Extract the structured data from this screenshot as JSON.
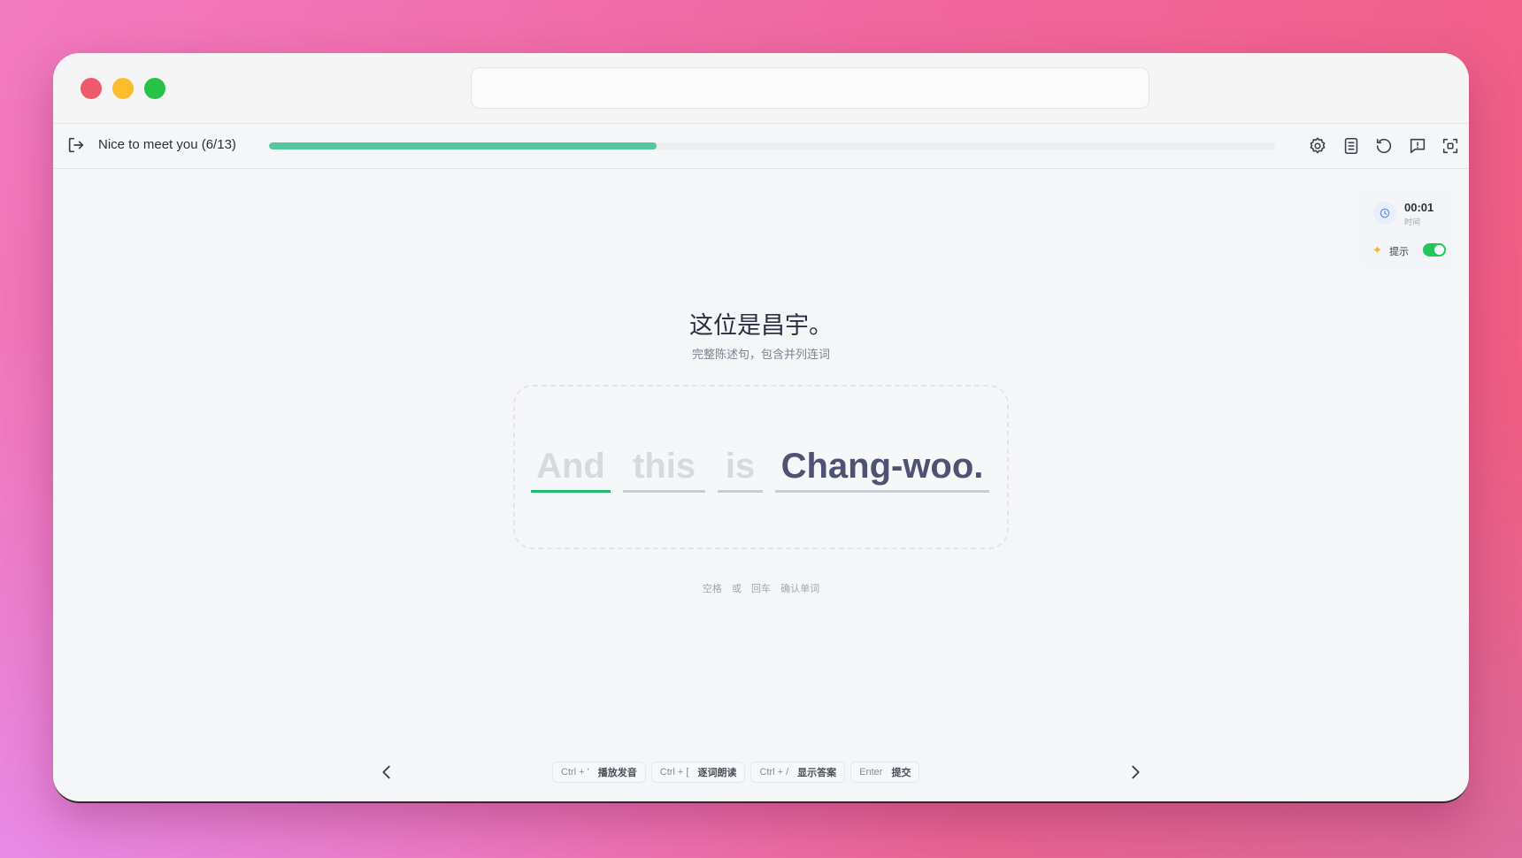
{
  "lesson": {
    "title": "Nice to meet you (6/13)",
    "progress_percent": 38.5
  },
  "toolbar": {
    "icons": [
      "settings-icon",
      "document-icon",
      "reset-icon",
      "feedback-icon",
      "fullscreen-icon"
    ]
  },
  "stats": {
    "timer_value": "00:01",
    "timer_label": "时间",
    "hint_label": "提示",
    "hint_enabled": true
  },
  "exercise": {
    "prompt": "这位是昌宇。",
    "prompt_sub": "完整陈述句，包含并列连词",
    "words": [
      {
        "text": "And",
        "state": "current"
      },
      {
        "text": "this",
        "state": "pending"
      },
      {
        "text": "is",
        "state": "pending"
      },
      {
        "text": "Chang-woo.",
        "state": "done"
      }
    ],
    "input_hint": "空格 或 回车 确认单词"
  },
  "shortcuts": [
    {
      "key": "Ctrl + '",
      "action": "播放发音"
    },
    {
      "key": "Ctrl + [",
      "action": "逐词朗读"
    },
    {
      "key": "Ctrl + /",
      "action": "显示答案"
    },
    {
      "key": "Enter",
      "action": "提交"
    }
  ],
  "colors": {
    "progress": "#56c79c",
    "current_word_underline": "#22b869",
    "toggle_on": "#22c55e"
  }
}
